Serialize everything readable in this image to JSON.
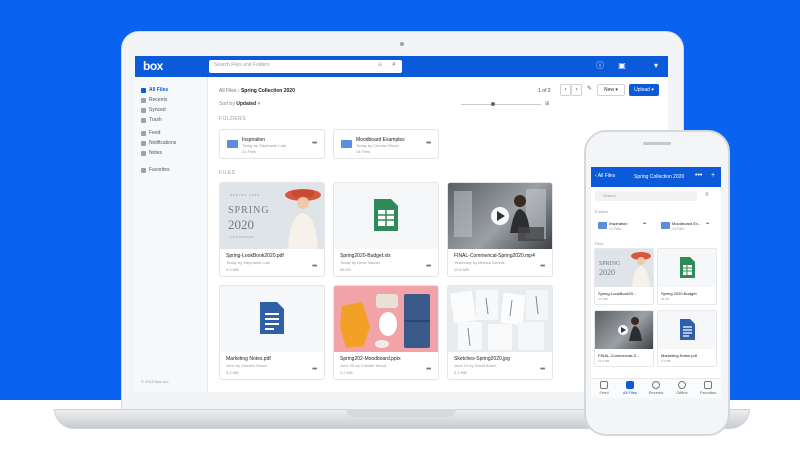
{
  "app": {
    "logo": "box",
    "search_placeholder": "Search Files and Folders",
    "breadcrumb": {
      "root": "All Files",
      "sep": "›",
      "current": "Spring Collection 2020"
    },
    "pager": "1 of 2",
    "new_label": "New",
    "upload_label": "Upload",
    "sort_label": "Sort by",
    "sort_value": "Updated",
    "folders_heading": "FOLDERS",
    "files_heading": "FILES",
    "copyright": "© 2019 Box Inc.",
    "sidebar": [
      {
        "label": "All Files",
        "icon": "folder-icon"
      },
      {
        "label": "Recents",
        "icon": "clock-icon"
      },
      {
        "label": "Synced",
        "icon": "sync-icon"
      },
      {
        "label": "Trash",
        "icon": "trash-icon"
      },
      {
        "label": "Feed",
        "icon": "feed-icon"
      },
      {
        "label": "Notifications",
        "icon": "bell-icon"
      },
      {
        "label": "Notes",
        "icon": "notes-icon"
      },
      {
        "label": "Favorites",
        "icon": "star-icon"
      }
    ],
    "folders": [
      {
        "name": "Inspiration",
        "sub": "Today by Stephanie Lark",
        "count": "21 Files"
      },
      {
        "name": "Moodboard Examples",
        "sub": "Today by Chester Wood",
        "count": "14 Files"
      }
    ],
    "files": [
      {
        "name": "Spring-LookBook2020.pdf",
        "sub": "Today by Stephanie Lark",
        "size": "3.2 MB",
        "thumb": "lookbook"
      },
      {
        "name": "Spring2020-Budget.xls",
        "sub": "Today by Drew Vander",
        "size": "65 KB",
        "thumb": "sheet"
      },
      {
        "name": "FINAL-Commerical-Spring2020.mp4",
        "sub": "Yesterday by Monica Dennis",
        "size": "19.6 MB",
        "thumb": "video"
      },
      {
        "name": "Marketing Notes.pdf",
        "sub": "June by Chester Wood",
        "size": "0.2 MB",
        "thumb": "doc"
      },
      {
        "name": "Spring202-Moodboard.pptx",
        "sub": "June 20 by Chester Wood",
        "size": "3.2 MB",
        "thumb": "flatlay"
      },
      {
        "name": "Sketches-Spring2020.jpg",
        "sub": "June 19 by David Amez",
        "size": "3.2 MB",
        "thumb": "sketch"
      }
    ],
    "lookbook_text": {
      "top": "SPRING 2020",
      "big1": "SPRING",
      "big2": "2020",
      "sub": "LOOKBOOK"
    }
  },
  "phone": {
    "back_label": "All Files",
    "title": "Spring Collection 2020",
    "search_placeholder": "Search",
    "folders_heading": "Folders",
    "files_heading": "Files",
    "folders": [
      {
        "name": "Inspiration",
        "count": "21 Files"
      },
      {
        "name": "Moodboard Ex...",
        "count": "14 Files"
      }
    ],
    "files": [
      {
        "name": "Spring-LookBook20...",
        "meta": "3.2 MB"
      },
      {
        "name": "Spring 2020-Budget",
        "meta": "65 KB"
      },
      {
        "name": "FINAL-Commercial-S...",
        "meta": "19.6 MB"
      },
      {
        "name": "Marketing Notes.pdf",
        "meta": "0.2 MB"
      }
    ],
    "tabs": [
      {
        "label": "Feed",
        "icon": "feed-icon"
      },
      {
        "label": "All Files",
        "icon": "folder-icon"
      },
      {
        "label": "Recents",
        "icon": "clock-icon"
      },
      {
        "label": "Offline",
        "icon": "download-icon"
      },
      {
        "label": "Favorites",
        "icon": "star-icon"
      }
    ]
  },
  "colors": {
    "brand_blue": "#0b5ad9",
    "background_blue": "#0a63ef",
    "sheet_green": "#2e8b57",
    "doc_blue": "#2f5fa8"
  }
}
